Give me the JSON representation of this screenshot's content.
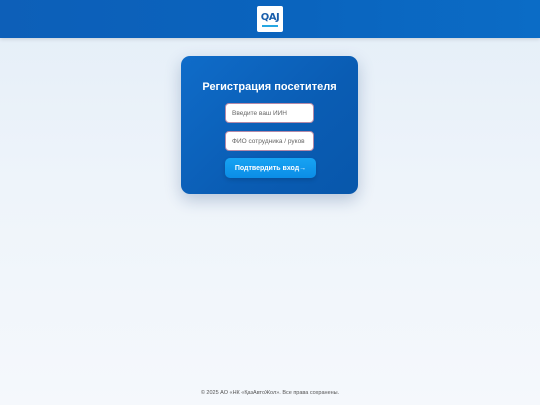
{
  "header": {
    "logo": {
      "text": "QAJ",
      "icon": "qaj-logo-icon"
    }
  },
  "form": {
    "title": "Регистрация посетителя",
    "iin_placeholder": "Введите ваш ИИН",
    "fio_placeholder": "ФИО сотрудника / руков",
    "submit_label": "Подтвердить вход→"
  },
  "footer": {
    "text": "© 2025 АО «НК «ҚазАвтоЖол». Все права сохранены."
  },
  "colors": {
    "header": "#0a63bd",
    "card": "#0a5cb3",
    "button": "#0f97ec",
    "page_bg": "#eef4fa"
  }
}
